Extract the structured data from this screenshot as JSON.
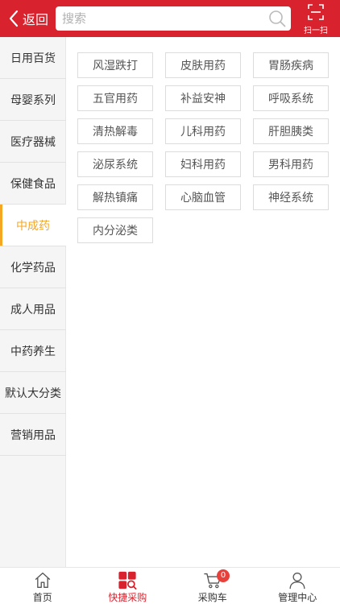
{
  "header": {
    "back_label": "返回",
    "search_placeholder": "搜索",
    "scan_label": "扫一扫",
    "brand_color": "#d8222d"
  },
  "sidebar": {
    "active_color": "#f5a623",
    "items": [
      {
        "label": "日用百货",
        "active": false
      },
      {
        "label": "母婴系列",
        "active": false
      },
      {
        "label": "医疗器械",
        "active": false
      },
      {
        "label": "保健食品",
        "active": false
      },
      {
        "label": "中成药",
        "active": true
      },
      {
        "label": "化学药品",
        "active": false
      },
      {
        "label": "成人用品",
        "active": false
      },
      {
        "label": "中药养生",
        "active": false
      },
      {
        "label": "默认大分类",
        "active": false
      },
      {
        "label": "营销用品",
        "active": false
      }
    ]
  },
  "subcategories": [
    "风湿跌打",
    "皮肤用药",
    "胃肠疾病",
    "五官用药",
    "补益安神",
    "呼吸系统",
    "清热解毒",
    "儿科用药",
    "肝胆胰类",
    "泌尿系统",
    "妇科用药",
    "男科用药",
    "解热镇痛",
    "心脑血管",
    "神经系统",
    "内分泌类"
  ],
  "bottom_nav": {
    "items": [
      {
        "label": "首页",
        "icon": "home-icon",
        "active": false
      },
      {
        "label": "快捷采购",
        "icon": "quick-purchase-icon",
        "active": true
      },
      {
        "label": "采购车",
        "icon": "cart-icon",
        "active": false,
        "badge": "0"
      },
      {
        "label": "管理中心",
        "icon": "user-icon",
        "active": false
      }
    ]
  }
}
